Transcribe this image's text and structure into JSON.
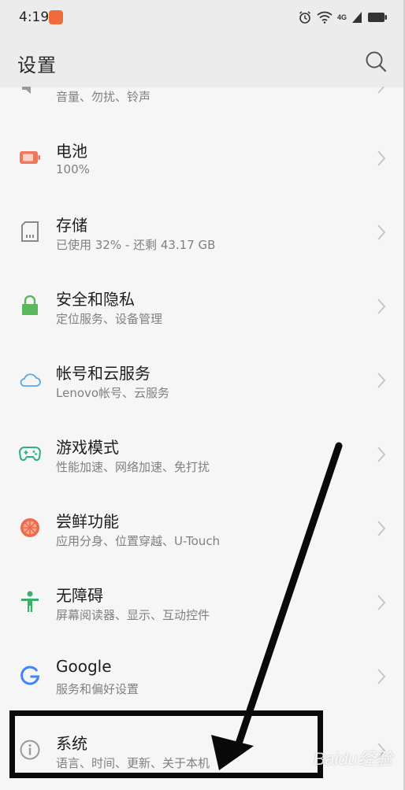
{
  "status_bar": {
    "time": "4:19",
    "network": "4G"
  },
  "header": {
    "title": "设置",
    "search_icon": "search-icon"
  },
  "partial_item": {
    "subtitle": "音量、勿扰、铃声",
    "icon": "speaker-icon"
  },
  "items": [
    {
      "label": "电池",
      "subtitle": "100%",
      "icon": "battery-icon",
      "color": "#f0775a"
    },
    {
      "label": "存储",
      "subtitle": "已使用 32% - 还剩 43.17 GB",
      "icon": "storage-icon",
      "color": "#8a8a8a"
    },
    {
      "label": "安全和隐私",
      "subtitle": "定位服务、设备管理",
      "icon": "lock-icon",
      "color": "#5cb85c"
    },
    {
      "label": "帐号和云服务",
      "subtitle": "Lenovo帐号、云服务",
      "icon": "cloud-icon",
      "color": "#5aa9e6"
    },
    {
      "label": "游戏模式",
      "subtitle": "性能加速、网络加速、免打扰",
      "icon": "gamepad-icon",
      "color": "#2db08a"
    },
    {
      "label": "尝鲜功能",
      "subtitle": "应用分身、位置穿越、U-Touch",
      "icon": "orange-slice-icon",
      "color": "#ee6a4a"
    },
    {
      "label": "无障碍",
      "subtitle": "屏幕阅读器、显示、互动控件",
      "icon": "accessibility-icon",
      "color": "#3bb06a"
    },
    {
      "label": "Google",
      "subtitle": "服务和偏好设置",
      "icon": "google-icon",
      "color": "#4285f4"
    },
    {
      "label": "系统",
      "subtitle": "语言、时间、更新、关于本机",
      "icon": "info-icon",
      "color": "#9a9a9a"
    }
  ],
  "watermark": "Baidu经验"
}
